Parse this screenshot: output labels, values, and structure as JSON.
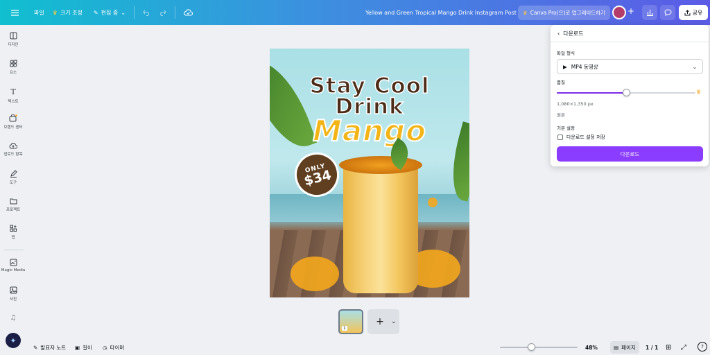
{
  "topbar": {
    "menu_icon": "hamburger-icon",
    "file_label": "파일",
    "resize_label": "크기 조정",
    "edit_mode_label": "편집 중",
    "design_title": "Yellow and Green Tropical Mango Drink Instagram Post",
    "upgrade_label": "Canva Pro(으)로 업그레이드하기",
    "add_label": "+",
    "share_label": "공유"
  },
  "sidebar": {
    "items": [
      {
        "label": "디자인",
        "icon": "layout-icon"
      },
      {
        "label": "요소",
        "icon": "shapes-icon"
      },
      {
        "label": "텍스트",
        "icon": "text-icon"
      },
      {
        "label": "브랜드 센터",
        "icon": "brand-icon"
      },
      {
        "label": "업로드 항목",
        "icon": "upload-cloud-icon"
      },
      {
        "label": "도구",
        "icon": "draw-tool-icon"
      },
      {
        "label": "프로젝트",
        "icon": "folder-icon"
      },
      {
        "label": "앱",
        "icon": "apps-icon"
      },
      {
        "label": "Magic Media",
        "icon": "magic-media-icon"
      },
      {
        "label": "사진",
        "icon": "photo-icon"
      }
    ]
  },
  "poster": {
    "line1": "Stay Cool",
    "line2": "Drink",
    "line3": "Mango",
    "price_only": "ONLY",
    "price_amount": "$34"
  },
  "pages": {
    "thumb_badge": "1",
    "add_label": "+"
  },
  "bottombar": {
    "notes_label": "발표자 노트",
    "duration_label": "길이",
    "timer_label": "타이머",
    "zoom_value": "48%",
    "zoom_fraction": 0.4,
    "page_view_label": "페이지",
    "page_count": "1 / 1",
    "help_label": "?"
  },
  "download_panel": {
    "title": "다운로드",
    "file_type_label": "파일 형식",
    "file_type_value": "MP4 동영상",
    "quality_label": "품질",
    "quality_fraction": 0.5,
    "dimensions": "1,080×1,350 px",
    "original_label": "원본",
    "basic_settings_label": "기본 설정",
    "save_settings_label": "다운로드 설정 저장",
    "save_settings_checked": false,
    "download_button": "다운로드"
  },
  "colors": {
    "accent_purple": "#8b3dff",
    "topbar_start": "#10bfd0",
    "topbar_end": "#5b5be6"
  }
}
